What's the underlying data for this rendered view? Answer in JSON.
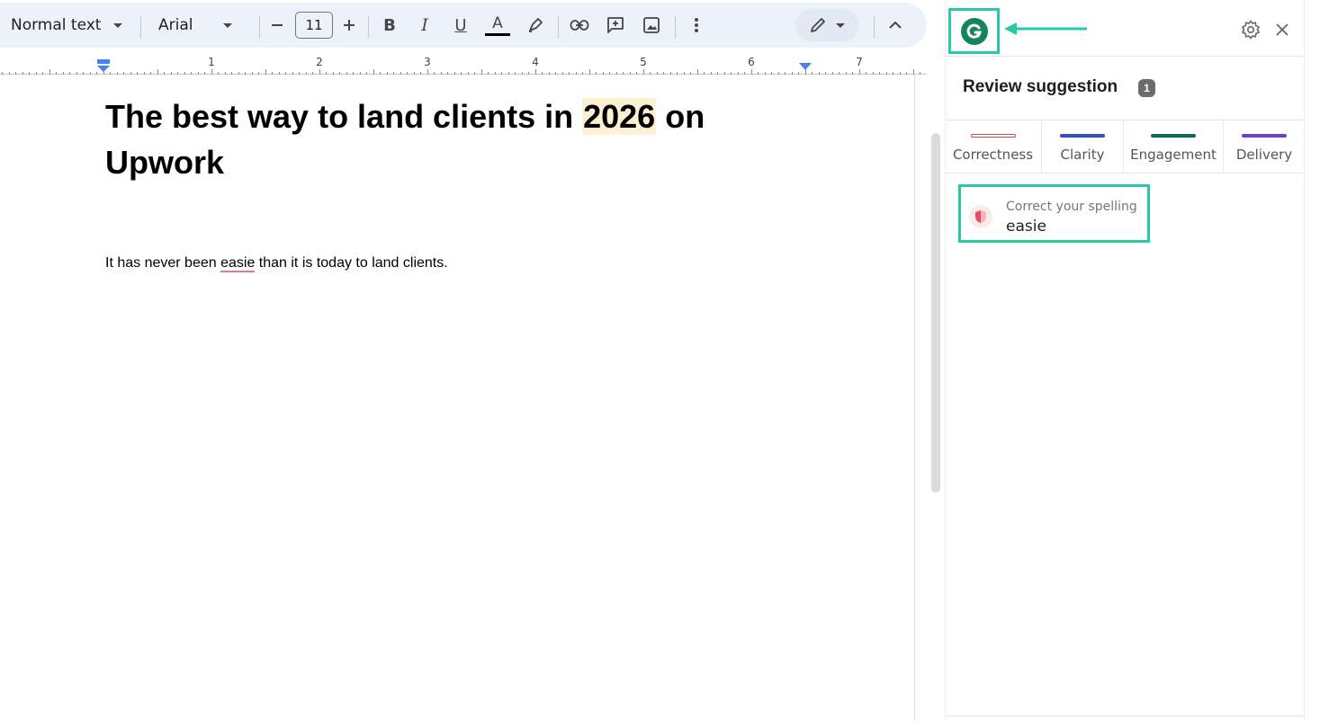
{
  "toolbar": {
    "style": "Normal text",
    "font": "Arial",
    "font_size": "11"
  },
  "ruler": {
    "numbers": [
      "1",
      "2",
      "3",
      "4",
      "5",
      "6",
      "7"
    ]
  },
  "document": {
    "title_before": "The best way to land clients in ",
    "title_highlight": "2026",
    "title_after": " on Upwork",
    "body_before": "It has never been ",
    "body_misspelled": "easie",
    "body_after": " than it is today to land clients."
  },
  "panel": {
    "title": "Review suggestion",
    "count": "1",
    "tabs": [
      {
        "label": "Correctness",
        "color": "#e06666"
      },
      {
        "label": "Clarity",
        "color": "#2f4fc8"
      },
      {
        "label": "Engagement",
        "color": "#0b6b52"
      },
      {
        "label": "Delivery",
        "color": "#6a3fd6"
      }
    ],
    "suggestion": {
      "category": "Correct your spelling",
      "word": "easie"
    }
  },
  "colors": {
    "highlight_box": "#28c9a6",
    "grammarly_green": "#15835c"
  }
}
